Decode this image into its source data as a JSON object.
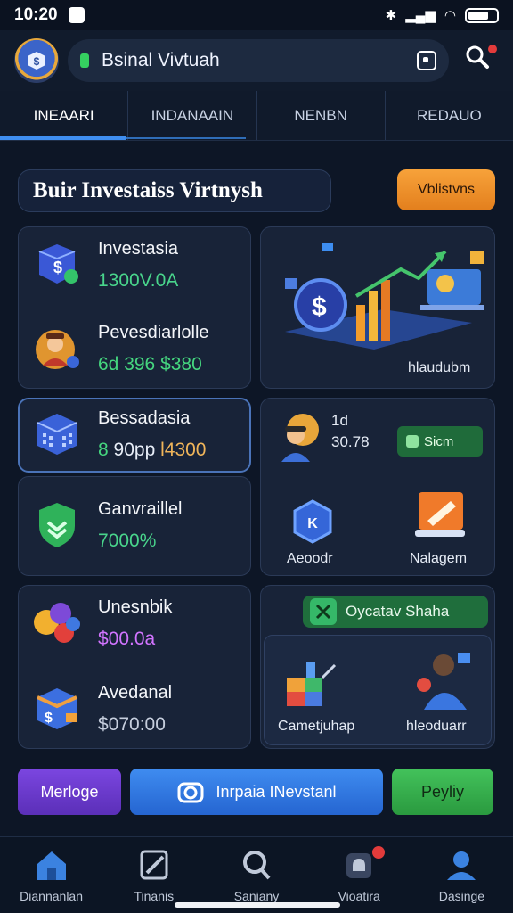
{
  "status_bar": {
    "time": "10:20"
  },
  "header": {
    "search_text": "Bsinal Vivtuah"
  },
  "tabs": [
    {
      "label": "INEAARI",
      "active": true
    },
    {
      "label": "INDANAAIN",
      "active": false
    },
    {
      "label": "NENBN",
      "active": false
    },
    {
      "label": "REDAUO",
      "active": false
    }
  ],
  "hero": {
    "title": "Buir Investaiss Virtnysh",
    "cta_label": "Vblistvns"
  },
  "cards": {
    "investasia": {
      "label": "Investasia",
      "value": "1300V.0A"
    },
    "pevesdiar": {
      "label": "Pevesdiarlolle",
      "value_a": "6d 396",
      "value_b": "$380"
    },
    "bessadasia": {
      "label": "Bessadasia",
      "value_a": "8",
      "value_b": "90pp",
      "value_c": "l4300"
    },
    "ganvraillel": {
      "label": "Ganvraillel",
      "value": "7000%"
    },
    "unesnbik": {
      "label": "Unesnbik",
      "value": "$00.0a"
    },
    "avedanal": {
      "label": "Avedanal",
      "value": "$070:00"
    }
  },
  "illustration": {
    "caption": "hlaudubm"
  },
  "right_panel": {
    "stat_top": "1d",
    "stat_bottom": "30.78",
    "badge": "Sicm",
    "item_left_label": "Aeoodr",
    "item_right_label": "Nalagem"
  },
  "share_panel": {
    "share_label": "Oycatav Shaha",
    "left_label": "Cametjuhap",
    "right_label": "hleoduarr"
  },
  "actions": {
    "left_label": "Merloge",
    "center_label": "Inrpaia INevstanl",
    "right_label": "Peyliy"
  },
  "bottom_nav": [
    {
      "label": "Diannanlan",
      "icon": "home-icon",
      "active": true
    },
    {
      "label": "Tinanis",
      "icon": "edit-icon",
      "active": false
    },
    {
      "label": "Saniany",
      "icon": "search-icon",
      "active": false
    },
    {
      "label": "Vioatira",
      "icon": "notification-icon",
      "active": false
    },
    {
      "label": "Dasinge",
      "icon": "profile-icon",
      "active": false
    }
  ],
  "colors": {
    "accent": "#3f8ef0",
    "positive": "#49d58c",
    "warning": "#f0a23a",
    "purple": "#7b46e0"
  }
}
